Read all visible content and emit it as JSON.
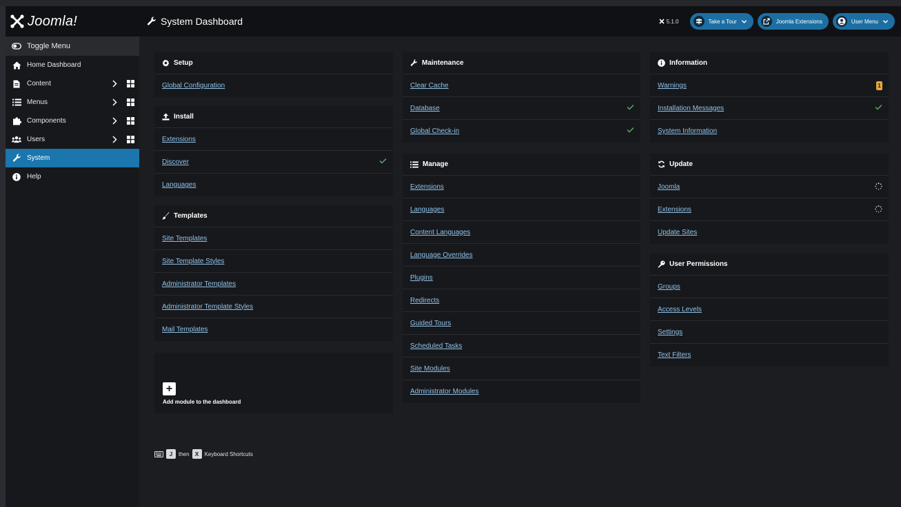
{
  "header": {
    "logo_text": "Joomla!",
    "page_title": "System Dashboard",
    "version": "5.1.0",
    "take_tour": "Take a Tour",
    "extensions": "Joomla Extensions",
    "user_menu": "User Menu"
  },
  "sidebar": {
    "toggle": "Toggle Menu",
    "items": [
      {
        "label": "Home Dashboard",
        "icon": "home-icon"
      },
      {
        "label": "Content",
        "icon": "file-icon"
      },
      {
        "label": "Menus",
        "icon": "list-icon"
      },
      {
        "label": "Components",
        "icon": "puzzle-icon"
      },
      {
        "label": "Users",
        "icon": "users-icon"
      },
      {
        "label": "System",
        "icon": "wrench-icon"
      },
      {
        "label": "Help",
        "icon": "info-icon"
      }
    ]
  },
  "cards": {
    "setup": {
      "title": "Setup",
      "links": [
        "Global Configuration"
      ]
    },
    "install": {
      "title": "Install",
      "links": [
        "Extensions",
        "Discover",
        "Languages"
      ]
    },
    "templates": {
      "title": "Templates",
      "links": [
        "Site Templates",
        "Site Template Styles",
        "Administrator Templates",
        "Administrator Template Styles",
        "Mail Templates"
      ]
    },
    "maintenance": {
      "title": "Maintenance",
      "links": [
        "Clear Cache",
        "Database",
        "Global Check-in"
      ]
    },
    "manage": {
      "title": "Manage",
      "links": [
        "Extensions",
        "Languages",
        "Content Languages",
        "Language Overrides",
        "Plugins",
        "Redirects",
        "Guided Tours",
        "Scheduled Tasks",
        "Site Modules",
        "Administrator Modules"
      ]
    },
    "information": {
      "title": "Information",
      "links": [
        "Warnings",
        "Installation Messages",
        "System Information"
      ],
      "warning_count": "1"
    },
    "update": {
      "title": "Update",
      "links": [
        "Joomla",
        "Extensions",
        "Update Sites"
      ]
    },
    "permissions": {
      "title": "User Permissions",
      "links": [
        "Groups",
        "Access Levels",
        "Settings",
        "Text Filters"
      ]
    }
  },
  "add_module": "Add module to the dashboard",
  "shortcuts": {
    "key1": "J",
    "then": "then",
    "key2": "X",
    "label": "Keyboard Shortcuts"
  },
  "colors": {
    "accent": "#1a76ad",
    "link": "#8fc3e8",
    "check": "#5aa86a",
    "warning": "#e8a53b"
  }
}
